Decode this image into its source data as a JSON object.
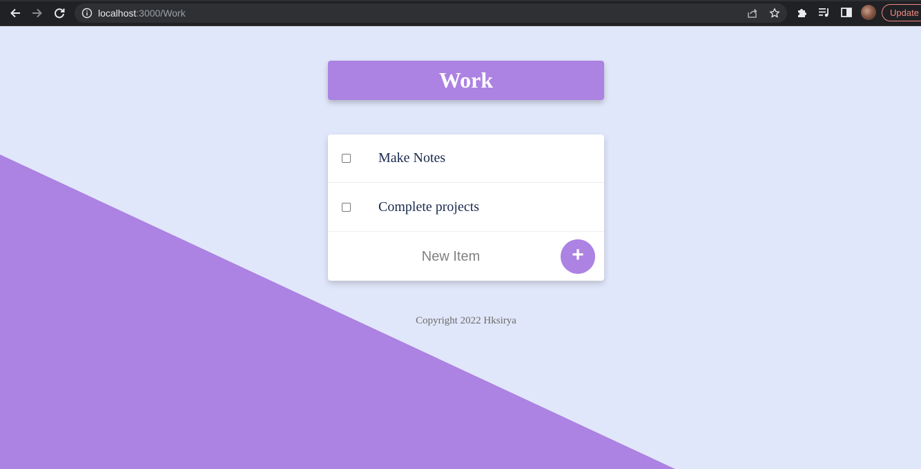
{
  "browser": {
    "url_host": "localhost",
    "url_path": ":3000/Work",
    "update_label": "Update"
  },
  "page": {
    "title": "Work",
    "items": [
      {
        "label": "Make Notes",
        "checked": false
      },
      {
        "label": "Complete projects",
        "checked": false
      }
    ],
    "new_item_placeholder": "New Item",
    "add_button_label": "+",
    "footer": "Copyright 2022 Hksirya"
  },
  "colors": {
    "background": "#e1e7fa",
    "accent": "#ac82e2",
    "chrome": "#202124"
  }
}
